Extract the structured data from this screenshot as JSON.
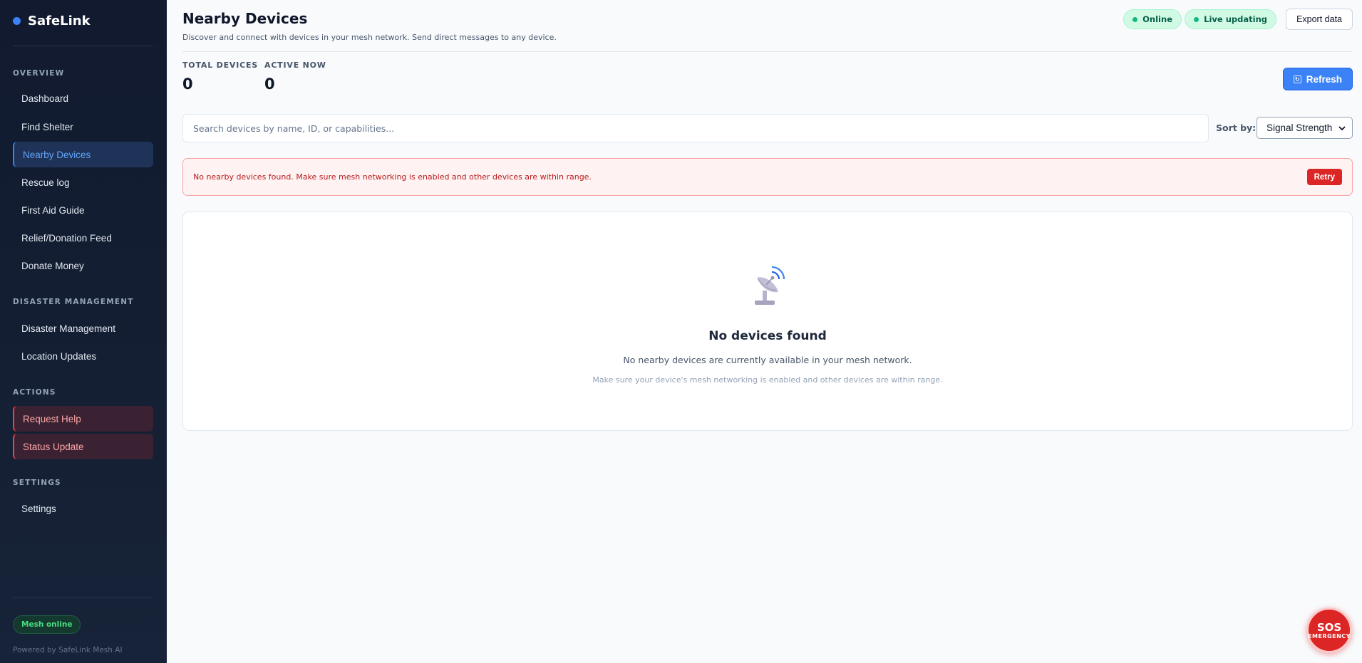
{
  "sidebar": {
    "brand": "SafeLink",
    "sections": {
      "overview": "OVERVIEW",
      "disaster": "DISASTER MANAGEMENT",
      "actions": "ACTIONS",
      "settings": "SETTINGS"
    },
    "items": {
      "dashboard": "Dashboard",
      "find_shelter": "Find Shelter",
      "nearby_devices": "Nearby Devices",
      "rescue_log": "Rescue log",
      "first_aid": "First Aid Guide",
      "relief_feed": "Relief/Donation Feed",
      "donate_money": "Donate Money",
      "disaster_management": "Disaster Management",
      "location_updates": "Location Updates",
      "request_help": "Request Help",
      "status_update": "Status Update",
      "settings": "Settings"
    },
    "mesh_status": "Mesh online",
    "powered_by": "Powered by SafeLink Mesh AI"
  },
  "header": {
    "title": "Nearby Devices",
    "subtitle": "Discover and connect with devices in your mesh network. Send direct messages to any device.",
    "status_online": "Online",
    "status_live": "Live updating",
    "export_label": "Export data"
  },
  "stats": {
    "total_label": "TOTAL DEVICES",
    "total_value": "0",
    "active_label": "ACTIVE NOW",
    "active_value": "0",
    "refresh_label": "Refresh"
  },
  "search": {
    "placeholder": "Search devices by name, ID, or capabilities...",
    "value": "",
    "sort_label": "Sort by:",
    "sort_selected": "Signal Strength"
  },
  "error": {
    "message": "No nearby devices found. Make sure mesh networking is enabled and other devices are within range.",
    "retry_label": "Retry"
  },
  "empty": {
    "title": "No devices found",
    "subtitle": "No nearby devices are currently available in your mesh network.",
    "hint": "Make sure your device's mesh networking is enabled and other devices are within range."
  },
  "sos": {
    "main": "SOS",
    "sub": "EMERGENCY"
  },
  "colors": {
    "accent": "#3b82f6",
    "danger": "#dc2626",
    "success": "#10b981",
    "sidebar_bg": "#111a2e"
  }
}
